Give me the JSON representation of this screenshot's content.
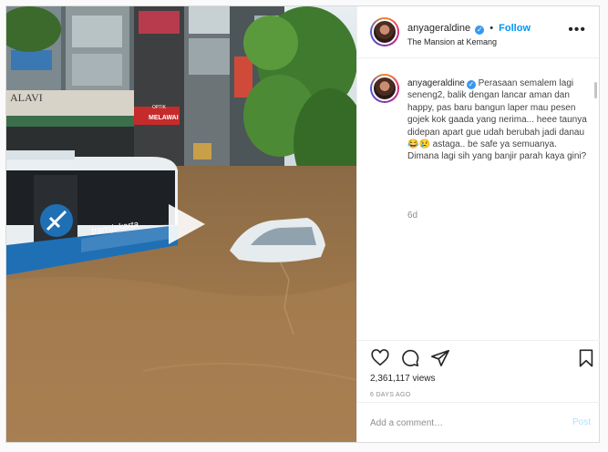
{
  "post": {
    "username": "anyageraldine",
    "verified_mark": "✓",
    "dot": "•",
    "follow_label": "Follow",
    "location": "The Mansion at Kemang",
    "more_icon": "more-dots-icon",
    "more_label": "•••"
  },
  "media": {
    "sign_left": "ALAVI",
    "sign_optik": "OPTIK",
    "sign_melawai": "MELAWAI",
    "bus_brand": "transjakarta",
    "play_icon": "play-icon"
  },
  "caption": {
    "username": "anyageraldine",
    "text": " Perasaan semalem lagi seneng2, balik dengan lancar aman dan happy, pas baru bangun laper mau pesen gojek kok gaada yang nerima... heee taunya didepan apart gue udah berubah jadi danau 😂😢 astaga.. be safe ya semuanya. Dimana lagi sih yang banjir parah kaya gini?",
    "age": "6d"
  },
  "actions": {
    "icons": [
      "heart-icon",
      "comment-icon",
      "share-icon",
      "bookmark-icon"
    ],
    "views": "2,361,117 views",
    "time_ago": "6 DAYS AGO"
  },
  "comment": {
    "placeholder": "Add a comment…",
    "post_label": "Post"
  },
  "colors": {
    "accent": "#0095f6",
    "verified": "#3897f0",
    "water": "#9a7448",
    "bus_blue": "#1f6fb5"
  }
}
